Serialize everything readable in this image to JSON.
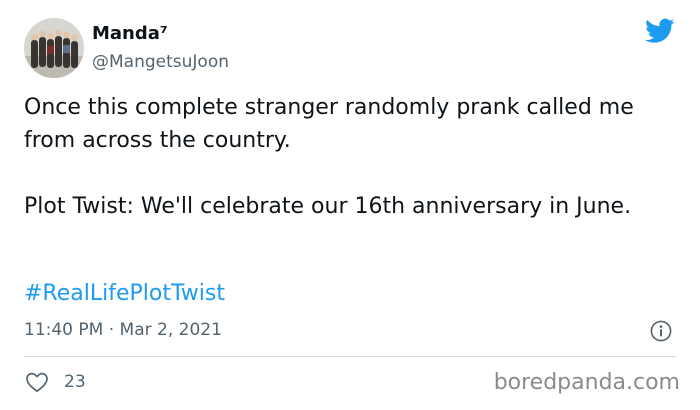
{
  "author": {
    "display_name": "Manda⁷",
    "handle": "@MangetsuJoon",
    "avatar_icon": "group-photo-avatar"
  },
  "tweet": {
    "paragraphs": [
      "Once this complete stranger randomly prank called me from across the country.",
      "Plot Twist: We'll celebrate our 16th anniversary in June."
    ],
    "hashtag": "#RealLifePlotTwist",
    "time": "11:40 PM",
    "separator": "·",
    "date": "Mar 2, 2021"
  },
  "actions": {
    "like_icon": "heart-icon",
    "like_count": "23",
    "info_icon": "info-icon"
  },
  "brand": {
    "icon": "twitter-bird-icon",
    "color": "#1d9bf0"
  },
  "watermark": {
    "text": "boredpanda.com"
  }
}
